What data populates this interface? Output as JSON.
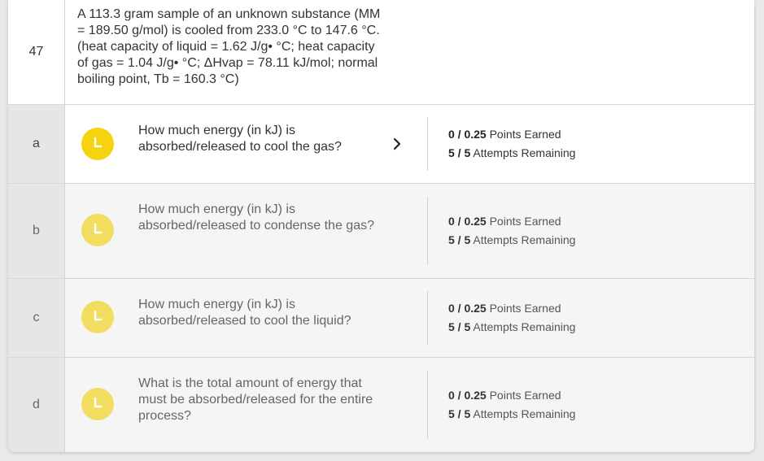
{
  "problem": {
    "number": "47",
    "text": "A 113.3 gram sample of an unknown substance (MM\n= 189.50 g/mol) is cooled from 233.0 °C to 147.6 °C.\n(heat capacity of liquid = 1.62 J/g• °C; heat capacity\nof gas = 1.04 J/g• °C; ΔHvap = 78.11 kJ/mol; normal\nboiling point, Tb = 160.3 °C)"
  },
  "parts": [
    {
      "letter": "a",
      "question": "How much energy (in kJ) is absorbed/released to cool the gas?",
      "points_value": "0 / 0.25",
      "points_label": "Points Earned",
      "attempts_value": "5 / 5",
      "attempts_label": "Attempts Remaining",
      "active": true
    },
    {
      "letter": "b",
      "question": "How much energy (in kJ) is absorbed/released to condense the gas?",
      "points_value": "0 / 0.25",
      "points_label": "Points Earned",
      "attempts_value": "5 / 5",
      "attempts_label": "Attempts Remaining",
      "active": false
    },
    {
      "letter": "c",
      "question": "How much energy (in kJ) is absorbed/released to cool the liquid?",
      "points_value": "0 / 0.25",
      "points_label": "Points Earned",
      "attempts_value": "5 / 5",
      "attempts_label": "Attempts Remaining",
      "active": false
    },
    {
      "letter": "d",
      "question": "What is the total amount of energy that must be absorbed/released for the entire process?",
      "points_value": "0 / 0.25",
      "points_label": "Points Earned",
      "attempts_value": "5 / 5",
      "attempts_label": "Attempts Remaining",
      "active": false
    }
  ],
  "icons": {
    "status": "clock-icon",
    "expand": "chevron-right-icon"
  },
  "colors": {
    "clock_active": "#f5d30f",
    "clock_inactive": "#f3dd60"
  }
}
